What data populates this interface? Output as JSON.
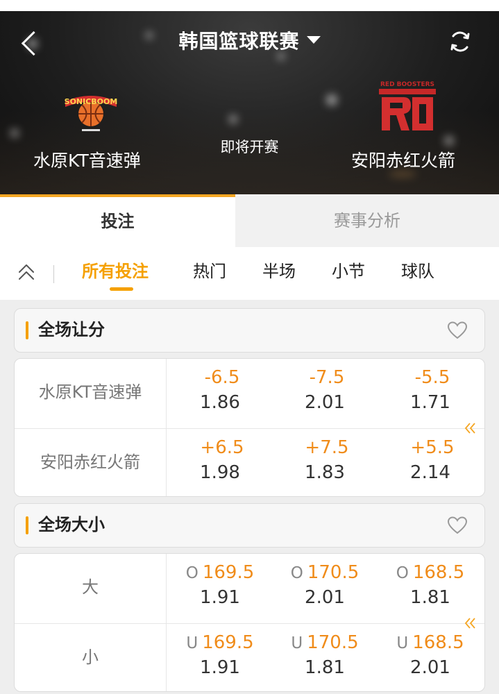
{
  "header": {
    "title": "韩国篮球联赛",
    "status": "即将开赛",
    "home_team": "水原KT音速弹",
    "away_team": "安阳赤红火箭",
    "home_logo_text": "SONICBOOM",
    "away_logo_text": "RED BOOSTERS"
  },
  "tabs": [
    {
      "label": "投注"
    },
    {
      "label": "赛事分析"
    }
  ],
  "subnav": {
    "items": [
      {
        "label": "所有投注"
      },
      {
        "label": "热门"
      },
      {
        "label": "半场"
      },
      {
        "label": "小节"
      },
      {
        "label": "球队"
      }
    ]
  },
  "sections": [
    {
      "title": "全场让分",
      "rows": [
        {
          "label": "水原KT音速弹",
          "odds": [
            {
              "prefix": "",
              "line": "-6.5",
              "price": "1.86"
            },
            {
              "prefix": "",
              "line": "-7.5",
              "price": "2.01"
            },
            {
              "prefix": "",
              "line": "-5.5",
              "price": "1.71"
            }
          ]
        },
        {
          "label": "安阳赤红火箭",
          "odds": [
            {
              "prefix": "",
              "line": "+6.5",
              "price": "1.98"
            },
            {
              "prefix": "",
              "line": "+7.5",
              "price": "1.83"
            },
            {
              "prefix": "",
              "line": "+5.5",
              "price": "2.14"
            }
          ]
        }
      ]
    },
    {
      "title": "全场大小",
      "rows": [
        {
          "label": "大",
          "odds": [
            {
              "prefix": "O",
              "line": "169.5",
              "price": "1.91"
            },
            {
              "prefix": "O",
              "line": "170.5",
              "price": "2.01"
            },
            {
              "prefix": "O",
              "line": "168.5",
              "price": "1.81"
            }
          ]
        },
        {
          "label": "小",
          "odds": [
            {
              "prefix": "U",
              "line": "169.5",
              "price": "1.91"
            },
            {
              "prefix": "U",
              "line": "170.5",
              "price": "1.81"
            },
            {
              "prefix": "U",
              "line": "168.5",
              "price": "2.01"
            }
          ]
        }
      ]
    }
  ],
  "colors": {
    "accent": "#f5a000",
    "line_value": "#f08c1a",
    "header_bg": "#1e1e1e"
  },
  "icons": [
    "back-arrow-icon",
    "dropdown-caret-icon",
    "refresh-icon",
    "collapse-icon",
    "heart-icon",
    "double-chevron-left-icon"
  ]
}
